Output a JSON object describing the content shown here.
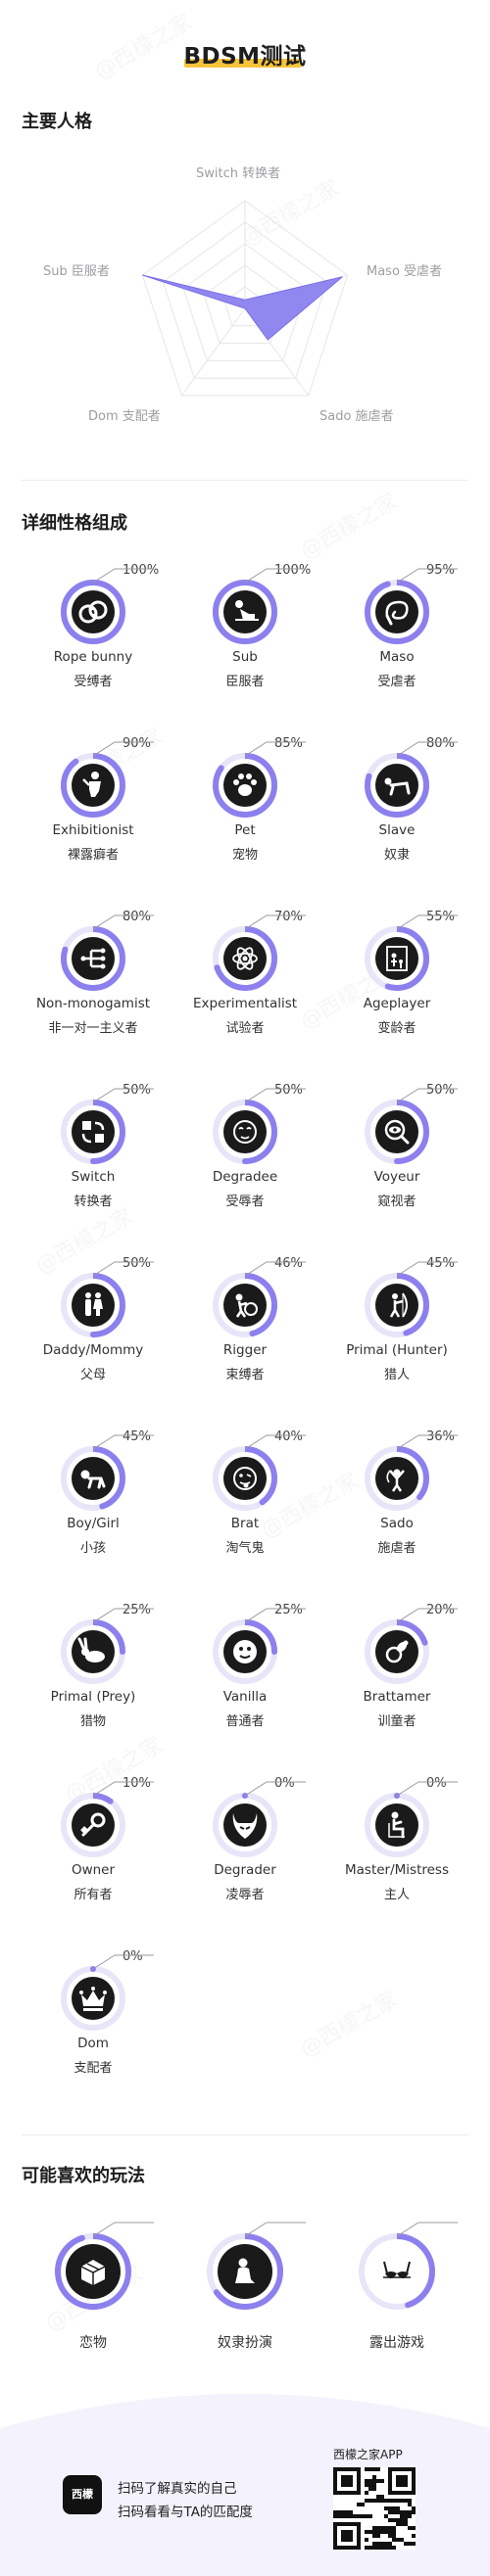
{
  "title": "BDSM测试",
  "colors": {
    "accent": "#8c80ee",
    "track": "#e7e5f8",
    "underline": "#f6c33a",
    "icon_bg": "#1a1a1a"
  },
  "watermark_text": "@西檬之家",
  "main_personality": {
    "heading": "主要人格",
    "axes": [
      {
        "label": "Switch 转换者",
        "value": 0.08
      },
      {
        "label": "Maso 受虐者",
        "value": 0.95
      },
      {
        "label": "Sado 施虐者",
        "value": 0.36
      },
      {
        "label": "Dom 支配者",
        "value": 0.0
      },
      {
        "label": "Sub 臣服者",
        "value": 1.0
      }
    ]
  },
  "detail": {
    "heading": "详细性格组成",
    "traits": [
      {
        "pct": "100%",
        "value": 100,
        "en": "Rope bunny",
        "zh": "受缚者",
        "icon": "rope-icon"
      },
      {
        "pct": "100%",
        "value": 100,
        "en": "Sub",
        "zh": "臣服者",
        "icon": "kneeling-person-icon"
      },
      {
        "pct": "95%",
        "value": 95,
        "en": "Maso",
        "zh": "受虐者",
        "icon": "whip-icon"
      },
      {
        "pct": "90%",
        "value": 90,
        "en": "Exhibitionist",
        "zh": "裸露癖者",
        "icon": "exhibitionist-icon"
      },
      {
        "pct": "85%",
        "value": 85,
        "en": "Pet",
        "zh": "宠物",
        "icon": "paw-icon"
      },
      {
        "pct": "80%",
        "value": 80,
        "en": "Slave",
        "zh": "奴隶",
        "icon": "crawling-person-icon"
      },
      {
        "pct": "80%",
        "value": 80,
        "en": "Non-monogamist",
        "zh": "非一对一主义者",
        "icon": "branch-icon"
      },
      {
        "pct": "70%",
        "value": 70,
        "en": "Experimentalist",
        "zh": "试验者",
        "icon": "atom-icon"
      },
      {
        "pct": "55%",
        "value": 55,
        "en": "Ageplayer",
        "zh": "变龄者",
        "icon": "ageplay-icon"
      },
      {
        "pct": "50%",
        "value": 50,
        "en": "Switch",
        "zh": "转换者",
        "icon": "swap-icon"
      },
      {
        "pct": "50%",
        "value": 50,
        "en": "Degradee",
        "zh": "受辱者",
        "icon": "shy-face-icon"
      },
      {
        "pct": "50%",
        "value": 50,
        "en": "Voyeur",
        "zh": "窥视者",
        "icon": "magnifier-eye-icon"
      },
      {
        "pct": "50%",
        "value": 50,
        "en": "Daddy/Mommy",
        "zh": "父母",
        "icon": "parents-icon"
      },
      {
        "pct": "46%",
        "value": 46,
        "en": "Rigger",
        "zh": "束缚者",
        "icon": "rigger-icon"
      },
      {
        "pct": "45%",
        "value": 45,
        "en": "Primal (Hunter)",
        "zh": "猎人",
        "icon": "hunter-icon"
      },
      {
        "pct": "45%",
        "value": 45,
        "en": "Boy/Girl",
        "zh": "小孩",
        "icon": "baby-icon"
      },
      {
        "pct": "40%",
        "value": 40,
        "en": "Brat",
        "zh": "淘气鬼",
        "icon": "tongue-face-icon"
      },
      {
        "pct": "36%",
        "value": 36,
        "en": "Sado",
        "zh": "施虐者",
        "icon": "whipping-person-icon"
      },
      {
        "pct": "25%",
        "value": 25,
        "en": "Primal (Prey)",
        "zh": "猎物",
        "icon": "rabbit-icon"
      },
      {
        "pct": "25%",
        "value": 25,
        "en": "Vanilla",
        "zh": "普通者",
        "icon": "smile-face-icon"
      },
      {
        "pct": "20%",
        "value": 20,
        "en": "Brattamer",
        "zh": "训童者",
        "icon": "pacifier-icon"
      },
      {
        "pct": "10%",
        "value": 10,
        "en": "Owner",
        "zh": "所有者",
        "icon": "key-icon"
      },
      {
        "pct": "0%",
        "value": 0,
        "en": "Degrader",
        "zh": "凌辱者",
        "icon": "devil-icon"
      },
      {
        "pct": "0%",
        "value": 0,
        "en": "Master/Mistress",
        "zh": "主人",
        "icon": "seated-person-icon"
      },
      {
        "pct": "0%",
        "value": 0,
        "en": "Dom",
        "zh": "支配者",
        "icon": "crown-icon"
      }
    ]
  },
  "plays": {
    "heading": "可能喜欢的玩法",
    "items": [
      {
        "label": "恋物",
        "value": 95,
        "icon": "box-icon"
      },
      {
        "label": "奴隶扮演",
        "value": 65,
        "icon": "kneeling-slave-icon"
      },
      {
        "label": "露出游戏",
        "value": 45,
        "icon": "bra-icon"
      }
    ]
  },
  "footer": {
    "logo_text": "西檬",
    "line1": "扫码了解真实的自己",
    "line2": "扫码看看与TA的匹配度",
    "app_name": "西檬之家APP"
  }
}
